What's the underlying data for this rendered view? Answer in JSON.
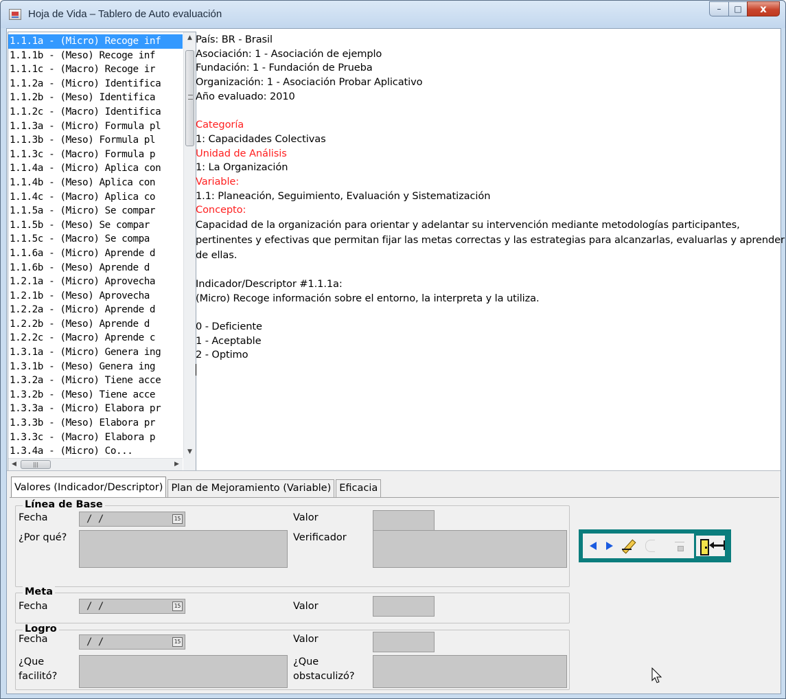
{
  "window": {
    "title": "Hoja de Vida – Tablero de Auto evaluación",
    "controls": {
      "minimize": "–",
      "maximize": "□",
      "close": "x"
    }
  },
  "indicator_list": {
    "selected_index": 0,
    "items": [
      "1.1.1a - (Micro) Recoge inf",
      "1.1.1b - (Meso) Recoge inf",
      "1.1.1c - (Macro) Recoge ir",
      "1.1.2a - (Micro) Identifica",
      "1.1.2b - (Meso) Identifica",
      "1.1.2c - (Macro) Identifica",
      "1.1.3a - (Micro) Formula pl",
      "1.1.3b - (Meso) Formula pl",
      "1.1.3c - (Macro) Formula p",
      "1.1.4a - (Micro) Aplica con",
      "1.1.4b - (Meso) Aplica con",
      "1.1.4c - (Macro) Aplica co",
      "1.1.5a - (Micro) Se compar",
      "1.1.5b - (Meso) Se compar",
      "1.1.5c - (Macro) Se compa",
      "1.1.6a - (Micro) Aprende d",
      "1.1.6b - (Meso) Aprende d",
      "1.2.1a - (Micro) Aprovecha",
      "1.2.1b - (Meso) Aprovecha",
      "1.2.2a - (Micro) Aprende d",
      "1.2.2b - (Meso) Aprende d",
      "1.2.2c - (Macro) Aprende c",
      "1.3.1a - (Micro) Genera ing",
      "1.3.1b - (Meso) Genera ing",
      "1.3.2a - (Micro) Tiene acce",
      "1.3.2b - (Meso) Tiene acce",
      "1.3.3a - (Micro) Elabora pr",
      "1.3.3b - (Meso) Elabora pr",
      "1.3.3c - (Macro) Elabora p",
      "1.3.4a - (Micro) Co..."
    ]
  },
  "info": {
    "pais": "País: BR - Brasil",
    "asociacion": "Asociación: 1 - Asociación de ejemplo",
    "fundacion": "Fundación: 1 - Fundación de Prueba",
    "organizacion": "Organización: 1 - Asociación Probar Aplicativo",
    "anio": "Año evaluado: 2010",
    "categoria_label": "Categoría",
    "categoria_value": "1: Capacidades Colectivas",
    "unidad_label": "Unidad de Análisis",
    "unidad_value": "1: La Organización",
    "variable_label": "Variable:",
    "variable_value": "1.1: Planeación, Seguimiento, Evaluación y Sistematización",
    "concepto_label": "Concepto:",
    "concepto_value": "Capacidad de la organización para orientar y adelantar su intervención mediante metodologías participantes, pertinentes y efectivas que permitan fijar las metas correctas y las estrategias para alcanzarlas, evaluarlas y aprender de ellas.",
    "indicador_title": "Indicador/Descriptor #1.1.1a:",
    "indicador_value": "(Micro) Recoge información sobre el entorno, la interpreta y la utiliza.",
    "scale": [
      "0 - Deficiente",
      "1 - Aceptable",
      "2 - Optimo"
    ]
  },
  "tabs": [
    {
      "label": "Valores (Indicador/Descriptor)",
      "active": true
    },
    {
      "label": "Plan de Mejoramiento (Variable)",
      "active": false
    },
    {
      "label": "Eficacia",
      "active": false
    }
  ],
  "linea_base": {
    "title": "Línea de Base",
    "fecha_label": "Fecha",
    "fecha_value": "/ /",
    "valor_label": "Valor",
    "porque_label": "¿Por qué?",
    "verificador_label": "Verificador"
  },
  "meta": {
    "title": "Meta",
    "fecha_label": "Fecha",
    "fecha_value": "/ /",
    "valor_label": "Valor"
  },
  "logro": {
    "title": "Logro",
    "fecha_label": "Fecha",
    "fecha_value": "/ /",
    "valor_label": "Valor",
    "facilito_label": "¿Que facilitó?",
    "obstaculizo_label": "¿Que obstaculizó?"
  },
  "calendar_glyph": "15",
  "colors": {
    "selection": "#3399ff",
    "label_red": "#ff2020",
    "toolbar_teal": "#0b7d7d",
    "nav_blue": "#1a5be0",
    "field_gray": "#c8c8c8"
  },
  "icons": [
    "prev-record-icon",
    "next-record-icon",
    "edit-pencil-icon",
    "undo-disabled-icon",
    "save-disabled-icon",
    "exit-door-icon",
    "calendar-icon",
    "mouse-pointer-icon"
  ]
}
